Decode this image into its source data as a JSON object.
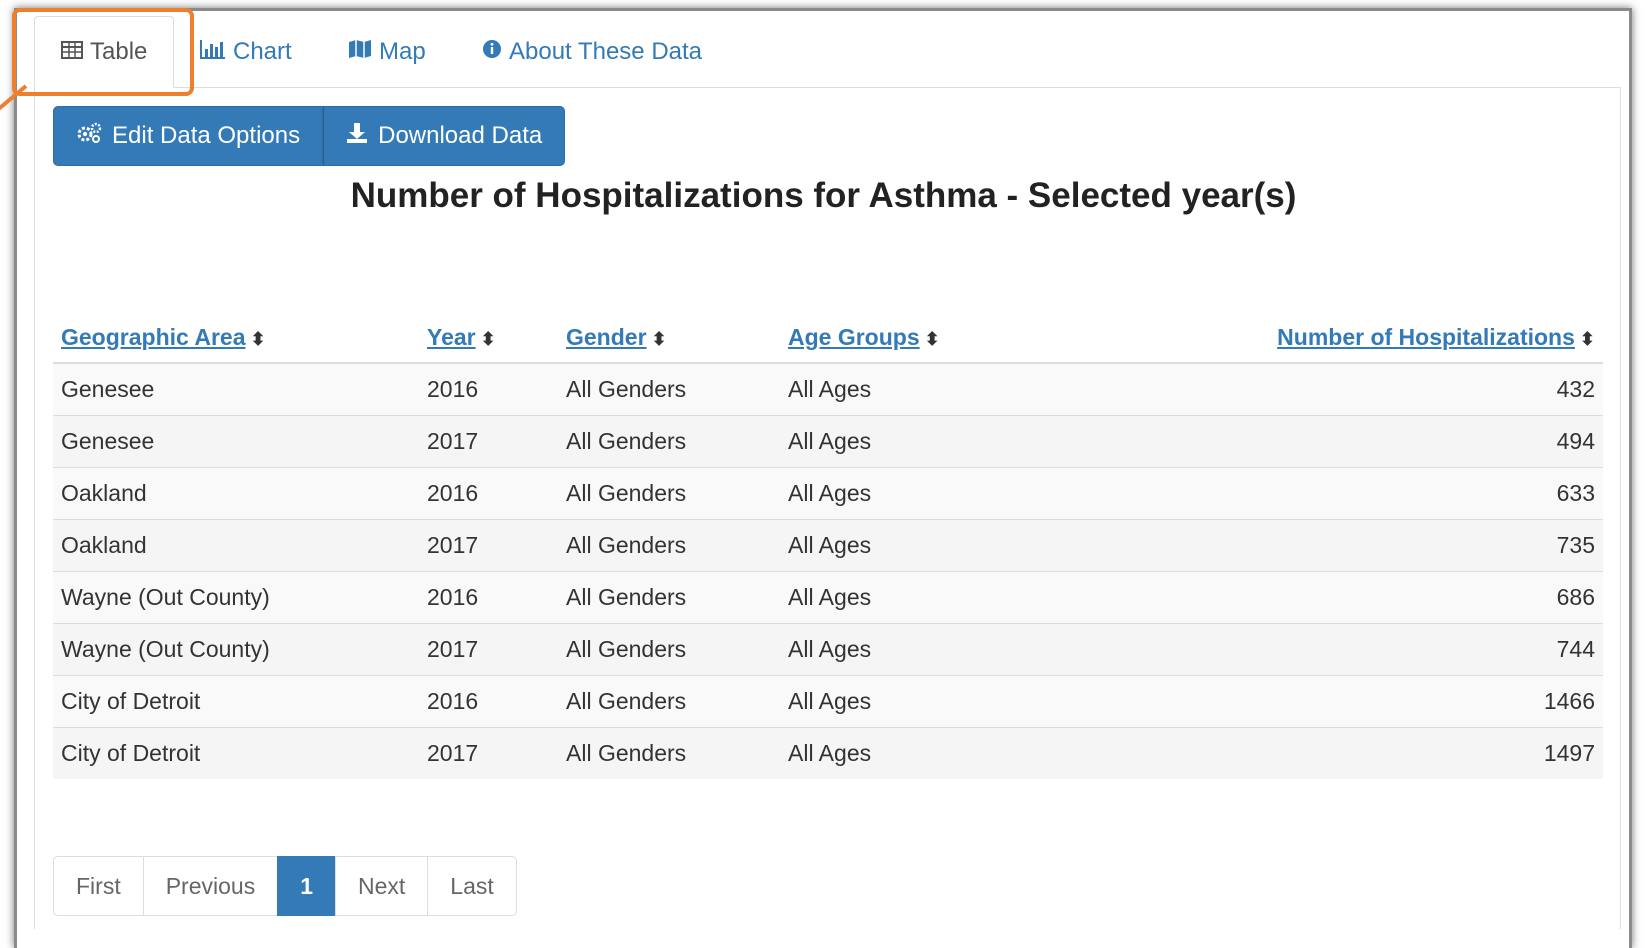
{
  "tabs": [
    {
      "label": "Table",
      "icon": "table-icon",
      "active": true
    },
    {
      "label": "Chart",
      "icon": "bar-chart-icon",
      "active": false
    },
    {
      "label": "Map",
      "icon": "map-icon",
      "active": false
    },
    {
      "label": "About These Data",
      "icon": "info-circle-icon",
      "active": false
    }
  ],
  "toolbar": {
    "edit_label": "Edit Data Options",
    "download_label": "Download Data"
  },
  "title": "Number of Hospitalizations for Asthma - Selected year(s)",
  "table": {
    "columns": [
      "Geographic Area",
      "Year",
      "Gender",
      "Age Groups",
      "Number of Hospitalizations"
    ],
    "rows": [
      [
        "Genesee",
        "2016",
        "All Genders",
        "All Ages",
        "432"
      ],
      [
        "Genesee",
        "2017",
        "All Genders",
        "All Ages",
        "494"
      ],
      [
        "Oakland",
        "2016",
        "All Genders",
        "All Ages",
        "633"
      ],
      [
        "Oakland",
        "2017",
        "All Genders",
        "All Ages",
        "735"
      ],
      [
        "Wayne (Out County)",
        "2016",
        "All Genders",
        "All Ages",
        "686"
      ],
      [
        "Wayne (Out County)",
        "2017",
        "All Genders",
        "All Ages",
        "744"
      ],
      [
        "City of Detroit",
        "2016",
        "All Genders",
        "All Ages",
        "1466"
      ],
      [
        "City of Detroit",
        "2017",
        "All Genders",
        "All Ages",
        "1497"
      ]
    ]
  },
  "pagination": {
    "first": "First",
    "previous": "Previous",
    "current": "1",
    "next": "Next",
    "last": "Last"
  },
  "colors": {
    "accent": "#337ab7",
    "highlight": "#ee7f2d"
  }
}
